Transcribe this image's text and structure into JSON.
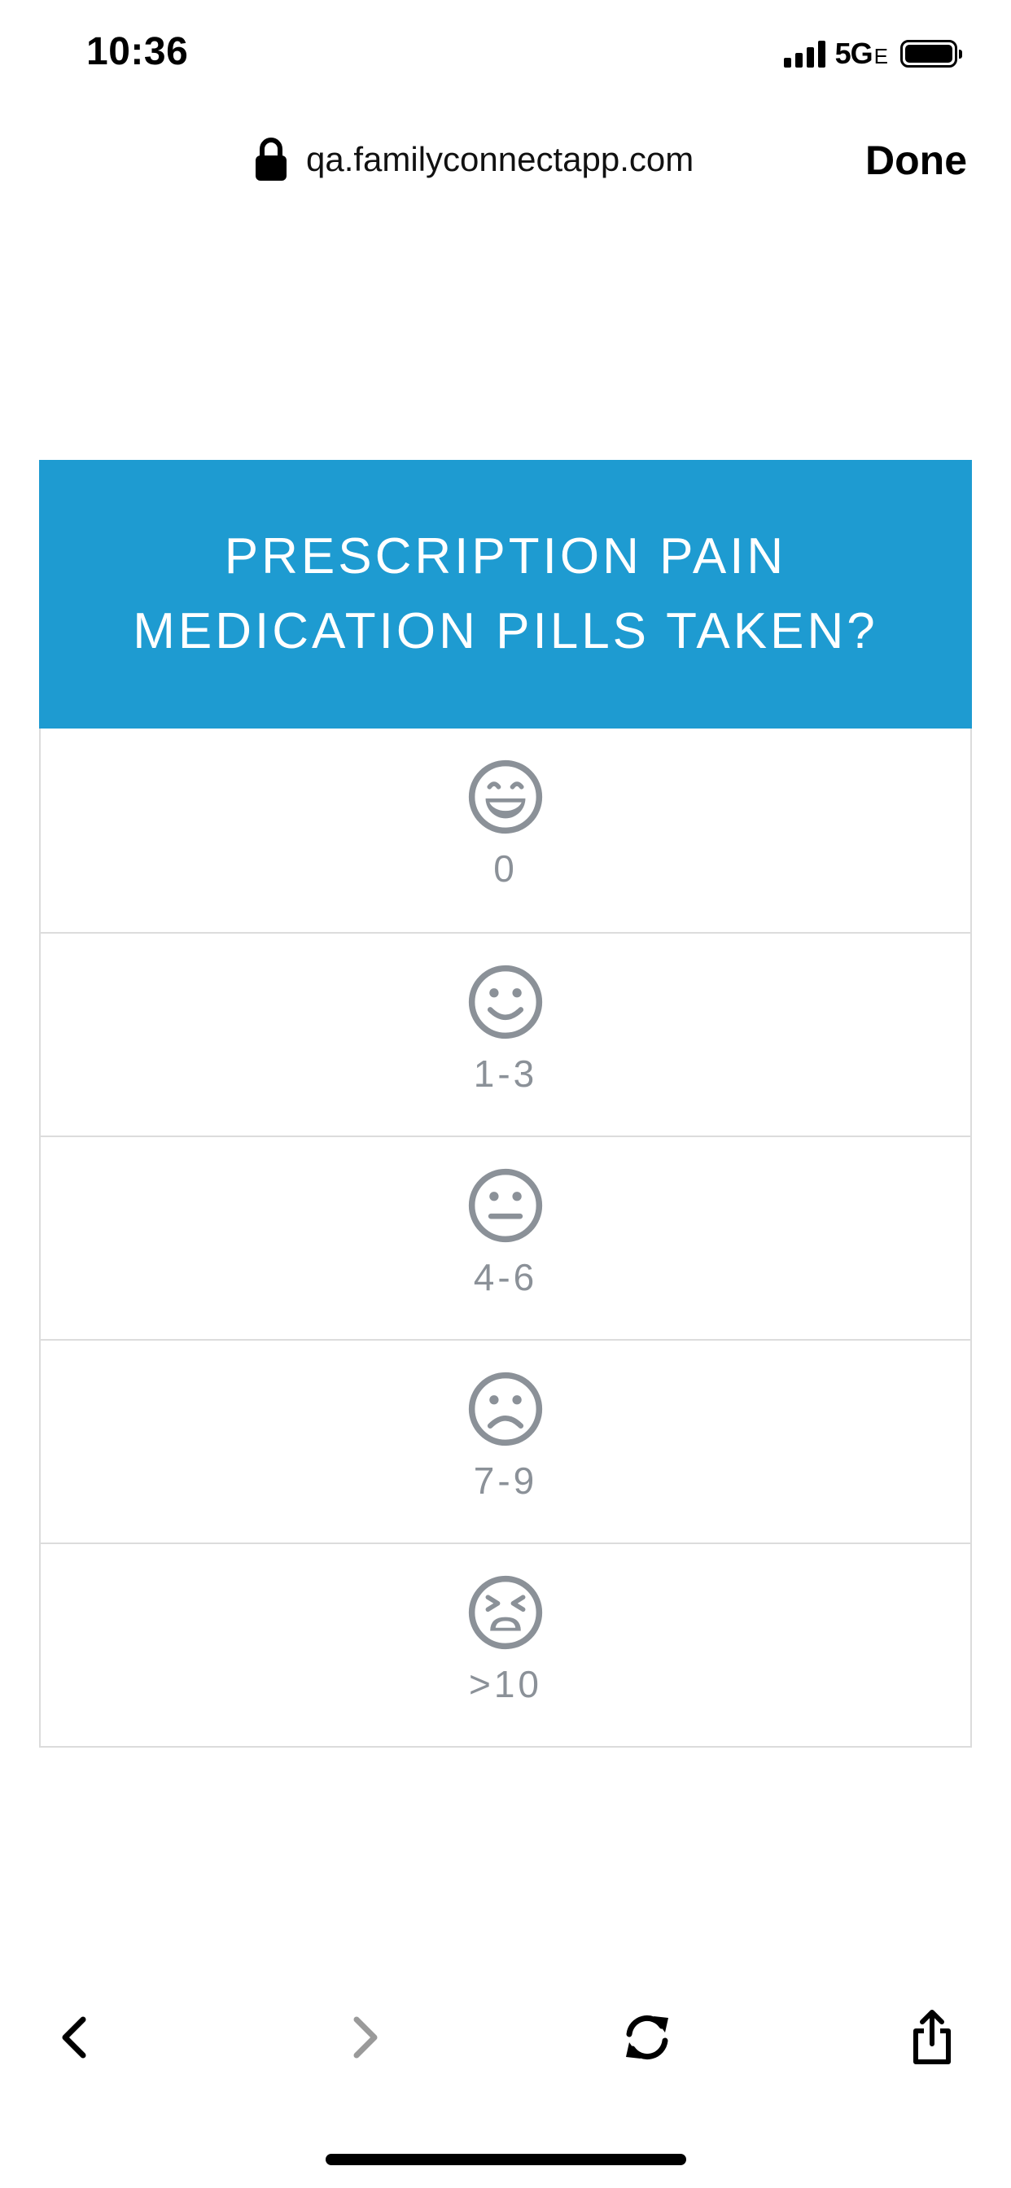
{
  "status_bar": {
    "time": "10:36",
    "network": "5G",
    "network_suffix": "E"
  },
  "browser": {
    "url": "qa.familyconnectapp.com",
    "done_label": "Done",
    "icons": {
      "lock": "lock-icon",
      "back": "chevron-left-icon",
      "forward": "chevron-right-icon",
      "reload": "reload-icon",
      "share": "share-icon"
    }
  },
  "question": {
    "title": "PRESCRIPTION PAIN\nMEDICATION PILLS TAKEN?",
    "header_color": "#1e9bd1",
    "options": [
      {
        "label": "0",
        "icon": "grinning-face-icon"
      },
      {
        "label": "1-3",
        "icon": "smiling-face-icon"
      },
      {
        "label": "4-6",
        "icon": "neutral-face-icon"
      },
      {
        "label": "7-9",
        "icon": "frowning-face-icon"
      },
      {
        "label": ">10",
        "icon": "tired-face-icon"
      }
    ]
  }
}
